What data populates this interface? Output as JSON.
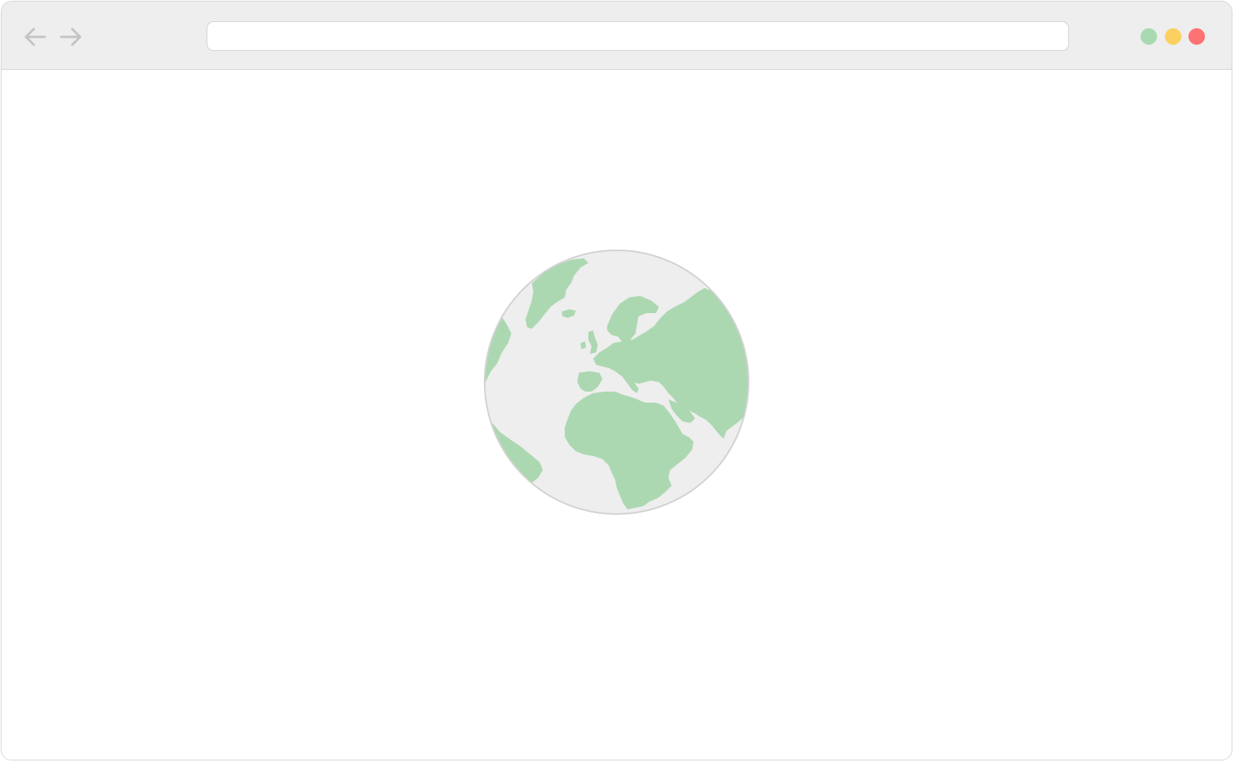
{
  "browser": {
    "address_bar": {
      "value": "",
      "placeholder": ""
    },
    "nav": {
      "back_icon": "arrow-left-icon",
      "forward_icon": "arrow-right-icon"
    },
    "window_controls": {
      "maximize_color": "#a9d9b1",
      "minimize_color": "#fbd060",
      "close_color": "#fd7373"
    }
  },
  "content": {
    "illustration": "globe-icon",
    "colors": {
      "ocean": "#eeeeee",
      "land": "#acd8b1",
      "outline": "#d2d2d2"
    }
  }
}
